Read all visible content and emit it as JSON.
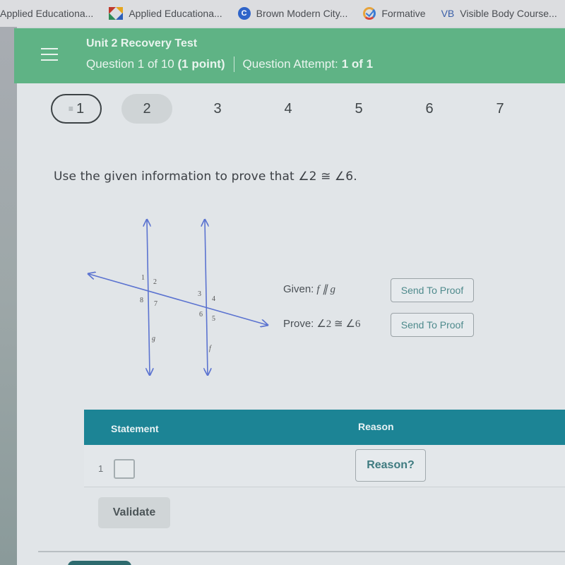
{
  "bookmarks": [
    {
      "label": "Applied Educationa...",
      "icon": "none"
    },
    {
      "label": "Applied Educationa...",
      "icon": "puzzle-icon"
    },
    {
      "label": "Brown Modern City...",
      "icon": "c-circle-icon"
    },
    {
      "label": "Formative",
      "icon": "check-circle-icon"
    },
    {
      "label": "Visible Body Course...",
      "icon": "vb-icon",
      "icon_text": "VB"
    }
  ],
  "header": {
    "title": "Unit 2 Recovery Test",
    "question_text": "Question 1 of 10",
    "points": "(1 point)",
    "attempt_label": "Question Attempt:",
    "attempt_value": "1 of 1",
    "color": "#5fb385"
  },
  "question_nav": [
    {
      "label": "1",
      "state": "current",
      "flag": "≡"
    },
    {
      "label": "2",
      "state": "visited"
    },
    {
      "label": "3",
      "state": "unvisited"
    },
    {
      "label": "4",
      "state": "unvisited"
    },
    {
      "label": "5",
      "state": "unvisited"
    },
    {
      "label": "6",
      "state": "unvisited"
    },
    {
      "label": "7",
      "state": "unvisited"
    }
  ],
  "prompt": "Use the given information to prove that ∠2 ≅ ∠6.",
  "diagram": {
    "line_color": "#5b73d0",
    "angle_labels": [
      "1",
      "2",
      "3",
      "4",
      "5",
      "6",
      "7",
      "8"
    ],
    "line_labels": {
      "left": "g",
      "right": "f"
    }
  },
  "given": {
    "label": "Given:",
    "expr": "f ∥ g",
    "button": "Send To Proof"
  },
  "prove": {
    "label": "Prove:",
    "expr": "∠2 ≅ ∠6",
    "button": "Send To Proof"
  },
  "proof_table": {
    "headers": {
      "statement": "Statement",
      "reason": "Reason"
    },
    "header_color": "#1c8495",
    "rows": [
      {
        "num": "1",
        "statement": "",
        "reason_button": "Reason?"
      }
    ]
  },
  "validate_label": "Validate"
}
